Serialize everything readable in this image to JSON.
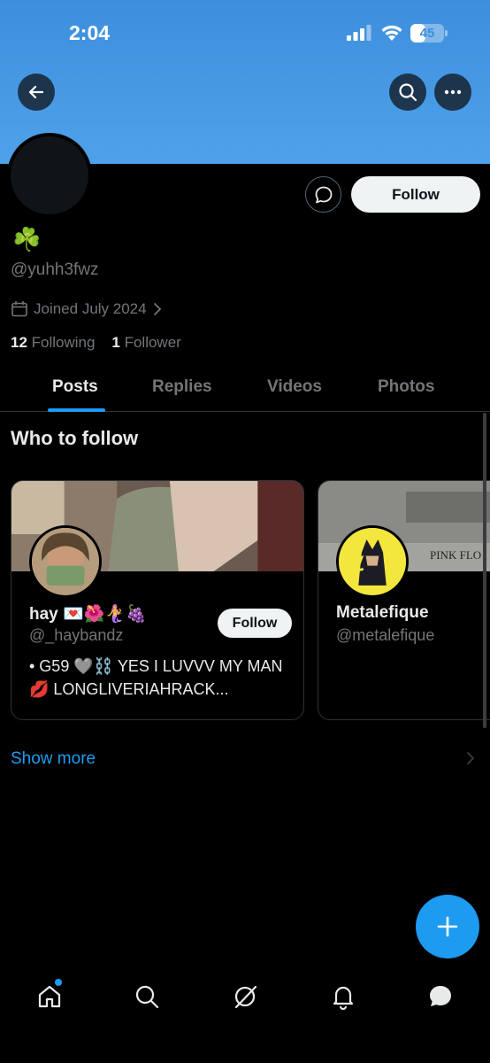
{
  "status_bar": {
    "time": "2:04",
    "battery_level": "45",
    "battery_fraction": 0.45
  },
  "header": {
    "back_icon": "arrow-left-icon",
    "search_icon": "search-icon",
    "more_icon": "more-horizontal-icon",
    "banner_color": "#4a9ae6"
  },
  "profile": {
    "display_name": "☘️",
    "handle": "@yuhh3fwz",
    "joined": "Joined July 2024",
    "following_count": "12",
    "following_label": "Following",
    "followers_count": "1",
    "followers_label": "Follower",
    "follow_button": "Follow"
  },
  "tabs": [
    {
      "label": "Posts",
      "active": true
    },
    {
      "label": "Replies",
      "active": false
    },
    {
      "label": "Videos",
      "active": false
    },
    {
      "label": "Photos",
      "active": false
    }
  ],
  "who_to_follow": {
    "title": "Who to follow",
    "cards": [
      {
        "name": "hay 💌🌺🧜‍♀️🍇",
        "handle": "@_haybandz",
        "bio": "• G59 🩶⛓️ YES I LUVVV MY MAN 💋 LONGLIVERIAHRACK...",
        "follow_label": "Follow"
      },
      {
        "name": "Metalefique",
        "handle": "@metalefique",
        "banner_text": "PINK FLO"
      }
    ],
    "show_more": "Show more"
  },
  "fab": {
    "icon": "plus-icon"
  },
  "bottom_nav": [
    {
      "icon": "home-icon",
      "has_badge": true
    },
    {
      "icon": "search-icon"
    },
    {
      "icon": "grok-icon"
    },
    {
      "icon": "bell-icon"
    },
    {
      "icon": "messages-icon"
    }
  ],
  "colors": {
    "accent": "#1d9bf0",
    "background": "#000000",
    "muted": "#71767b"
  }
}
